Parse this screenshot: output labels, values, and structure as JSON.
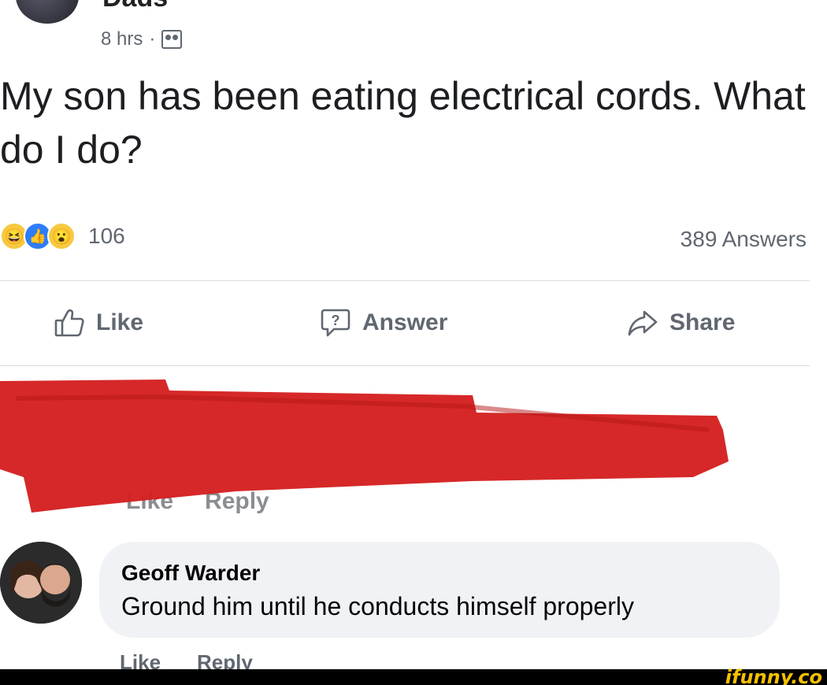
{
  "post": {
    "group_name": "Dads",
    "time": "8 hrs",
    "separator": "·",
    "text": "My son has been eating electrical cords. What do I do?",
    "reaction_count": "106",
    "answers_count": "389 Answers"
  },
  "actions": {
    "like": "Like",
    "answer": "Answer",
    "share": "Share"
  },
  "redacted_comment": {
    "like": "Like",
    "reply": "Reply",
    "redaction_color": "#d41f1f"
  },
  "comment": {
    "author": "Geoff Warder",
    "text": "Ground him until he conducts himself properly",
    "like": "Like",
    "reply": "Reply"
  },
  "watermark": "ifunny.co",
  "colors": {
    "secondary_text": "#606770",
    "bubble": "#f0f2f5",
    "like_blue": "#2e7cf6",
    "reaction_yellow": "#f7c940",
    "watermark": "#f6c000"
  },
  "icons": {
    "group": "group-icon",
    "like": "thumbs-up-icon",
    "answer": "question-bubble-icon",
    "share": "share-arrow-icon"
  }
}
